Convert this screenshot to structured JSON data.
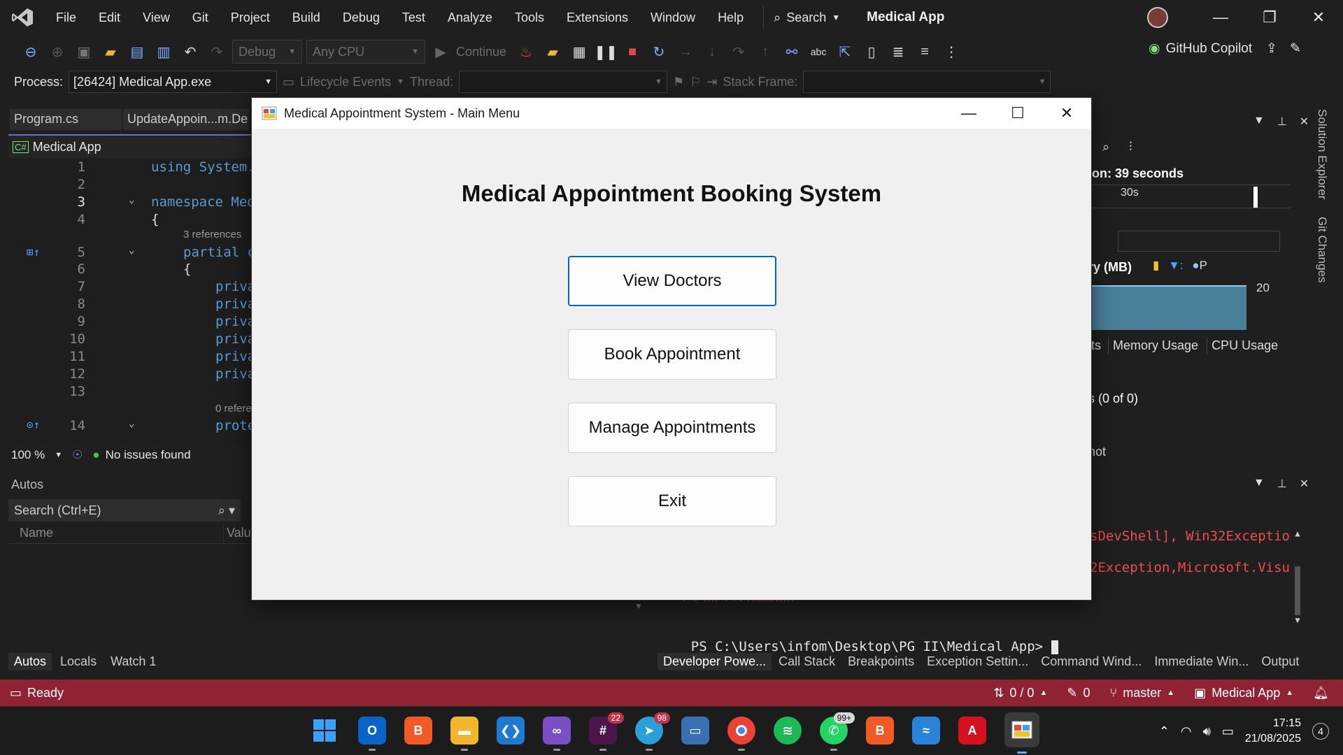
{
  "menubar": {
    "items": [
      "File",
      "Edit",
      "View",
      "Git",
      "Project",
      "Build",
      "Debug",
      "Test",
      "Analyze",
      "Tools",
      "Extensions",
      "Window",
      "Help"
    ],
    "search_label": "Search",
    "solution_name": "Medical App"
  },
  "toolbar": {
    "config": "Debug",
    "platform": "Any CPU",
    "continue_label": "Continue",
    "copilot_label": "GitHub Copilot"
  },
  "debugbar": {
    "process_label": "Process:",
    "process_value": "[26424] Medical App.exe",
    "lifecycle_label": "Lifecycle Events",
    "thread_label": "Thread:",
    "stack_frame_label": "Stack Frame:"
  },
  "editor": {
    "tabs": [
      "Program.cs",
      "UpdateAppoin...m.De"
    ],
    "header": "Medical App",
    "lines": [
      {
        "n": "1",
        "code": "using System."
      },
      {
        "n": "2",
        "code": ""
      },
      {
        "n": "3",
        "code": "namespace Med"
      },
      {
        "n": "4",
        "code": "{"
      },
      {
        "n": "5",
        "code": "partial c"
      },
      {
        "n": "6",
        "code": "{"
      },
      {
        "n": "7",
        "code": "priva"
      },
      {
        "n": "8",
        "code": "priva"
      },
      {
        "n": "9",
        "code": "priva"
      },
      {
        "n": "10",
        "code": "priva"
      },
      {
        "n": "11",
        "code": "priva"
      },
      {
        "n": "12",
        "code": "priva"
      },
      {
        "n": "13",
        "code": ""
      },
      {
        "n": "14",
        "code": "prote"
      }
    ],
    "hint_refs_3": "3 references",
    "hint_refs_0": "0 refere",
    "zoom": "100 %",
    "issues": "No issues found"
  },
  "autos": {
    "title": "Autos",
    "search_placeholder": "Search (Ctrl+E)",
    "col_name": "Name",
    "col_value": "Valu",
    "tabs": [
      "Autos",
      "Locals",
      "Watch 1"
    ]
  },
  "diagnostics": {
    "session": "ion: 39 seconds",
    "tick": "30s",
    "memory_label": "ry (MB)",
    "memory_value": "20",
    "tabs": [
      "ts",
      "Memory Usage",
      "CPU Usage"
    ],
    "events": "s (0 of 0)",
    "snapshot": "hot"
  },
  "terminal": {
    "error_1": "sDevShell], Win32Exceptio",
    "error_2": "2Exception,Microsoft.Visu",
    "error_3": "evShellCommand",
    "prompt": "PS C:\\Users\\infom\\Desktop\\PG II\\Medical App> "
  },
  "output_tabs": [
    "Developer Powe...",
    "Call Stack",
    "Breakpoints",
    "Exception Settin...",
    "Command Wind...",
    "Immediate Win...",
    "Output"
  ],
  "side_tabs": [
    "Solution Explorer",
    "Git Changes"
  ],
  "statusbar": {
    "ready": "Ready",
    "changes": "0 / 0",
    "edits": "0",
    "branch": "master",
    "repo": "Medical App"
  },
  "taskbar": {
    "time": "17:15",
    "date": "21/08/2025",
    "notifications": "4",
    "badges": {
      "slack": "22",
      "telegram": "98",
      "whatsapp": "99+"
    }
  },
  "dialog": {
    "title": "Medical Appointment System - Main Menu",
    "heading": "Medical Appointment Booking System",
    "buttons": {
      "view_doctors": "View Doctors",
      "book": "Book Appointment",
      "manage": "Manage Appointments",
      "exit": "Exit"
    }
  }
}
